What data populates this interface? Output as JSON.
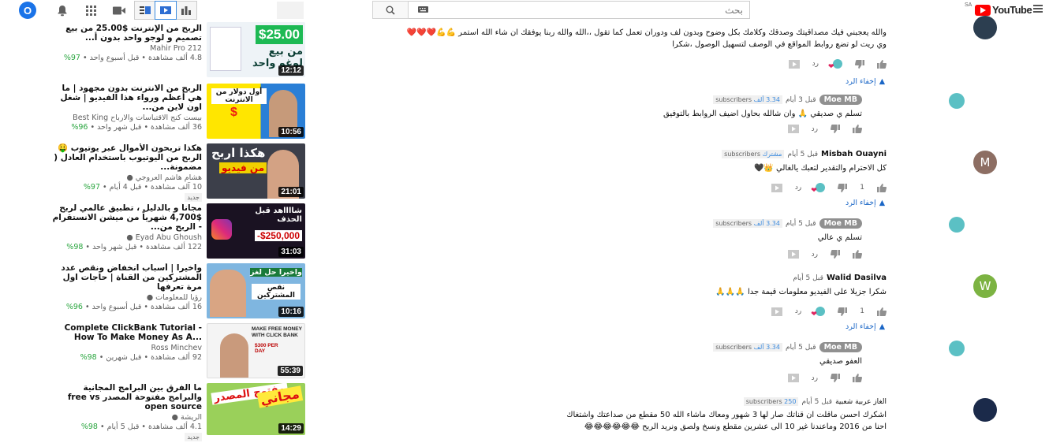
{
  "header": {
    "avatar_letter": "O",
    "search_placeholder": "بحث",
    "logo_text": "YouTube",
    "logo_region": "SA"
  },
  "related": [
    {
      "title": "الربح من الإنترنت $25.00 من بيع تصميم و لوجو واحد بدون أ...",
      "channel": "Mahir Pro 212",
      "meta": "4.8 ألف مشاهدة • قبل أسبوع واحد",
      "pct": "97%",
      "duration": "12:12",
      "thumb_text": "$25.00",
      "thumb_sub": "من بيع لوغو واحد",
      "is_new": false
    },
    {
      "title": "الربح من الانترنت بدون مجهود | ما هي أعظم ورواء هذا الفيديو | شغل اون لاين من...",
      "channel": "بيست كنج الاقتباسات والارباح Best King",
      "meta": "36 ألف مشاهدة • قبل شهر واحد",
      "pct": "96%",
      "duration": "10:56",
      "thumb_text": "أول دولار من الانترنت",
      "thumb_sub": "",
      "is_new": false
    },
    {
      "title": "هكذا تربحون الأموال عبر يوتيوب 🤑 الربح من اليوتيوب باستخدام العادل ( مضمونة...",
      "channel": "هشام هاشم العروجي",
      "meta": "10 آلف مشاهدة • قبل 4 أيام",
      "pct": "97%",
      "duration": "21:01",
      "thumb_text": "هكذا اربح",
      "thumb_sub": "من فيديو",
      "is_new": true
    },
    {
      "title": "مجاناً و بالدليل ، تطبيق عالمي لربح $4,700 شهرياً من ميشن الانستقرام - الربح من...",
      "channel": "Eyad Abu Ghoush",
      "meta": "122 ألف مشاهدة • قبل شهر واحد",
      "pct": "98%",
      "duration": "31:03",
      "thumb_text": "شااااهد قبل الحذف",
      "thumb_sub": "-$250,000",
      "is_new": false
    },
    {
      "title": "واخيرا | أسباب انخفاض ونقص عدد المشتركين من القناة | حاجات اول مرة تعرفها",
      "channel": "رؤيا للمعلومات",
      "meta": "16 ألف مشاهدة • قبل أسبوع واحد",
      "pct": "96%",
      "duration": "10:16",
      "thumb_text": "واخيرا حل لغز",
      "thumb_sub": "نقص المشتركين",
      "is_new": false
    },
    {
      "title": "Complete ClickBank Tutorial - How To Make Money As A...",
      "channel": "Ross Minchev",
      "meta": "92 ألف مشاهدة • قبل شهرين",
      "pct": "98%",
      "duration": "55:39",
      "thumb_text": "MAKE FREE MONEY WITH CLICK BANK",
      "thumb_sub": "$300 PER DAY",
      "is_new": false
    },
    {
      "title": "ما الفرق بين البرامج المجانية والبرامج مفتوحة المصدر free vs open source",
      "channel": "الريشة",
      "meta": "4.1 ألف مشاهدة • قبل 5 أيام",
      "pct": "98%",
      "duration": "14:29",
      "thumb_text": "مجاني",
      "thumb_sub": "مفتوح المصدر",
      "is_new": true
    }
  ],
  "comments": [
    {
      "text1": "والله يعجبني فيك مصداقيتك وصدقك وكلامك بكل وضوح وبدون لف ودوران تعمل كما تقول ،،الله والله ربنا يوفقك ان شاء الله استمر 💪💪❤️❤️❤️",
      "text2": "وي ريت لو تضع روابط المواقع في الوصف لتسهيل الوصول ،شكرا",
      "reply_label": "رد",
      "hide_replies": "إخفاء الرد"
    },
    {
      "author": "Moe MB",
      "time": "قبل 3 أيام",
      "subs_count": "3.34 ألف",
      "subs_label": "subscribers",
      "text1": "تسلم ي صديقي 🙏 وان شالله بحاول اضيف الروابط بالتوفيق",
      "reply_label": "رد"
    },
    {
      "author": "Misbah Ouayni",
      "time": "قبل 5 أيام",
      "subs_count": "مشترك",
      "subs_label": "subscribers",
      "avatar_letter": "M",
      "text1": "كل الاحترام والتقدير لتعبك يالغالي 👑🖤",
      "likes": "1",
      "reply_label": "رد",
      "hide_replies": "إخفاء الرد"
    },
    {
      "author": "Moe MB",
      "time": "قبل 5 أيام",
      "subs_count": "3.34 ألف",
      "subs_label": "subscribers",
      "text1": "تسلم ي عالي",
      "reply_label": "رد"
    },
    {
      "author": "Walid Dasilva",
      "time": "قبل 5 أيام",
      "avatar_letter": "W",
      "text1": "شكرا جزيلا على الفيديو معلومات قيمة جدا 🙏🙏🙏",
      "likes": "1",
      "reply_label": "رد",
      "hide_replies": "إخفاء الرد"
    },
    {
      "author": "Moe MB",
      "time": "قبل 5 أيام",
      "subs_count": "3.34 ألف",
      "subs_label": "subscribers",
      "text1": "العفو صديقي",
      "reply_label": "رد"
    },
    {
      "author": "الغاز عربية شعبية",
      "time": "قبل 5 أيام",
      "subs_count": "250",
      "subs_label": "subscribers",
      "text1": "اشكرك احسن ماقلت ان قناتك صار لها 3 شهور ومعاك ماشاء الله 50 مقطع من صداعتك واشتغاك",
      "text2": "احنا من 2016 وماعندنا غير 10 الى عشرين مقطع ونسخ ولصق ونريد الربح 😂😂😂😂😂😂"
    }
  ]
}
